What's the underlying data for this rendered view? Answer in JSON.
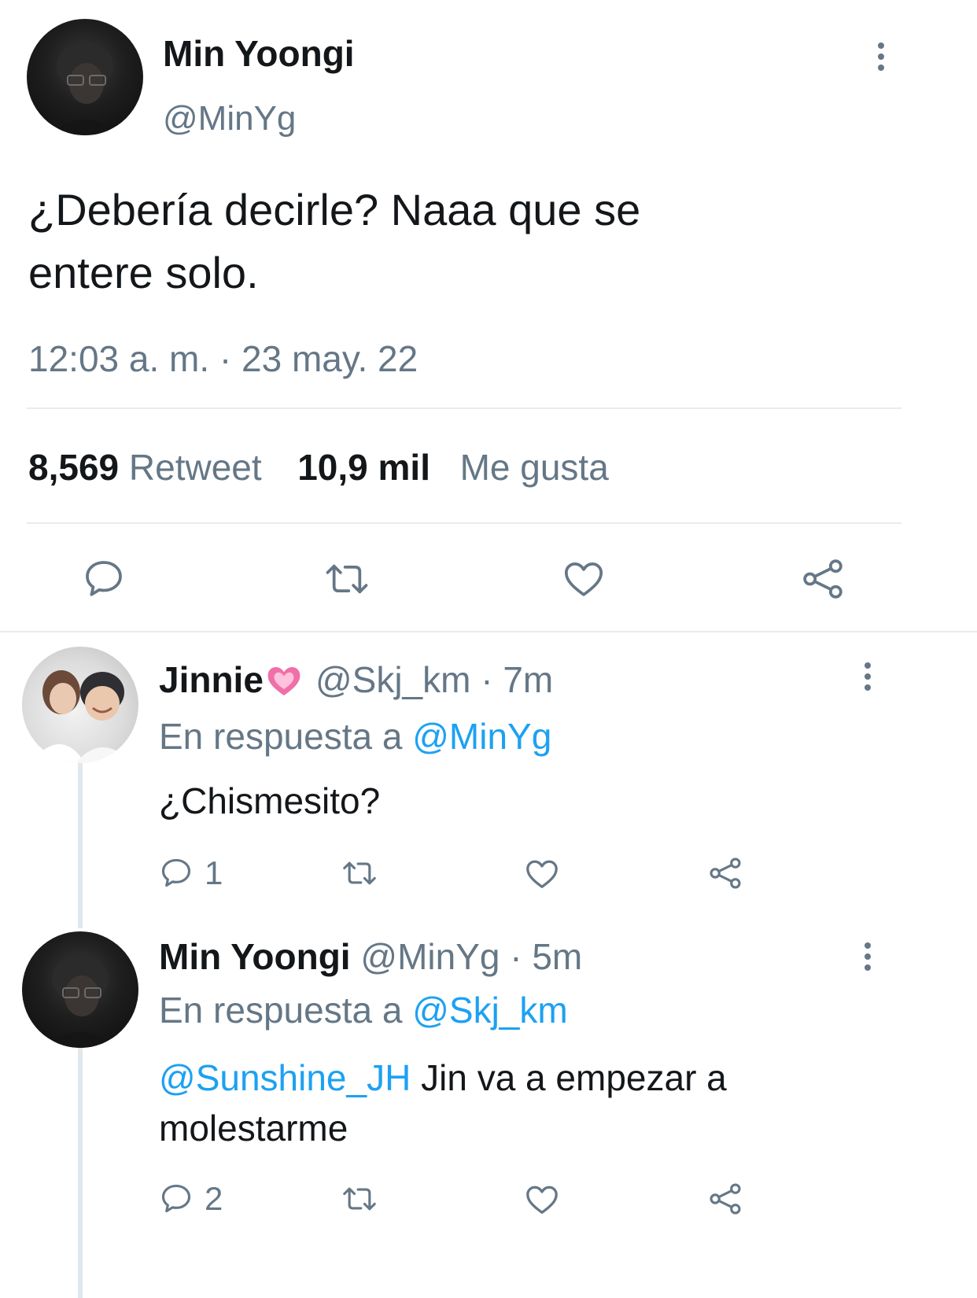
{
  "main_tweet": {
    "display_name": "Min Yoongi",
    "handle": "@MinYg",
    "text_line1": "¿Debería decirle? Naaa que se",
    "text_line2": "entere solo.",
    "timestamp": "12:03 a. m. · 23 may. 22",
    "retweet_count": "8,569",
    "retweet_label": "Retweet",
    "like_count": "10,9 mil",
    "like_label": "Me gusta"
  },
  "replies": [
    {
      "display_name": "Jinnie",
      "handle_time": "@Skj_km · 7m",
      "reply_prefix": "En respuesta a",
      "reply_to": "@MinYg",
      "text": "¿Chismesito?",
      "reply_count": "1"
    },
    {
      "display_name": "Min Yoongi",
      "handle_time": "@MinYg · 5m",
      "reply_prefix": "En respuesta a",
      "reply_to": "@Skj_km",
      "mention": "@Sunshine_JH",
      "text_line1": " Jin va a empezar a",
      "text_line2": "molestarme",
      "reply_count": "2"
    }
  ],
  "icons": [
    "more-dots-icon",
    "reply-icon",
    "retweet-icon",
    "like-icon",
    "share-icon",
    "pink-heart-emoji"
  ],
  "colors": {
    "text": "#14171a",
    "muted": "#657786",
    "link": "#1da1f2",
    "divider": "#e6ecf0",
    "pink": "#f06fa8"
  }
}
